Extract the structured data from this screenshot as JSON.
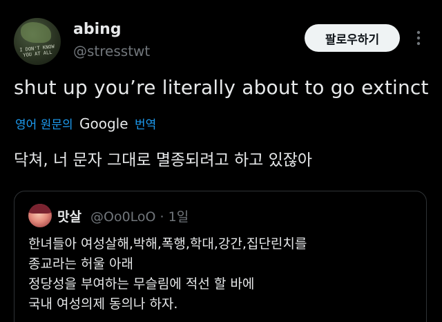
{
  "author": {
    "name": "abing",
    "handle": "@stresstwt",
    "avatar_scrawl": "I DON'T KNOW YOU AT ALL"
  },
  "actions": {
    "follow_label": "팔로우하기",
    "more_icon": "more-vertical-icon"
  },
  "tweet": {
    "text": "shut up you’re literally about to go extinct",
    "translate_prefix": "영어 원문의",
    "translate_brand": "Google",
    "translate_suffix": "번역",
    "translation": "닥쳐, 너 문자 그대로 멸종되려고 하고 있잖아"
  },
  "quote": {
    "name": "맛살",
    "handle": "@Oo0LoO",
    "separator": "·",
    "time": "1일",
    "lines": [
      "한녀들아 여성살해,박해,폭행,학대,강간,집단린치를",
      "종교라는 허울 아래",
      "정당성을 부여하는 무슬림에 적선 할 바에",
      "국내 여성의제 동의나 하자."
    ]
  },
  "colors": {
    "background": "#000000",
    "text": "#e7e9ea",
    "muted": "#71767b",
    "link": "#1d9bf0",
    "border": "#2f3336",
    "button_bg": "#eff3f4"
  }
}
